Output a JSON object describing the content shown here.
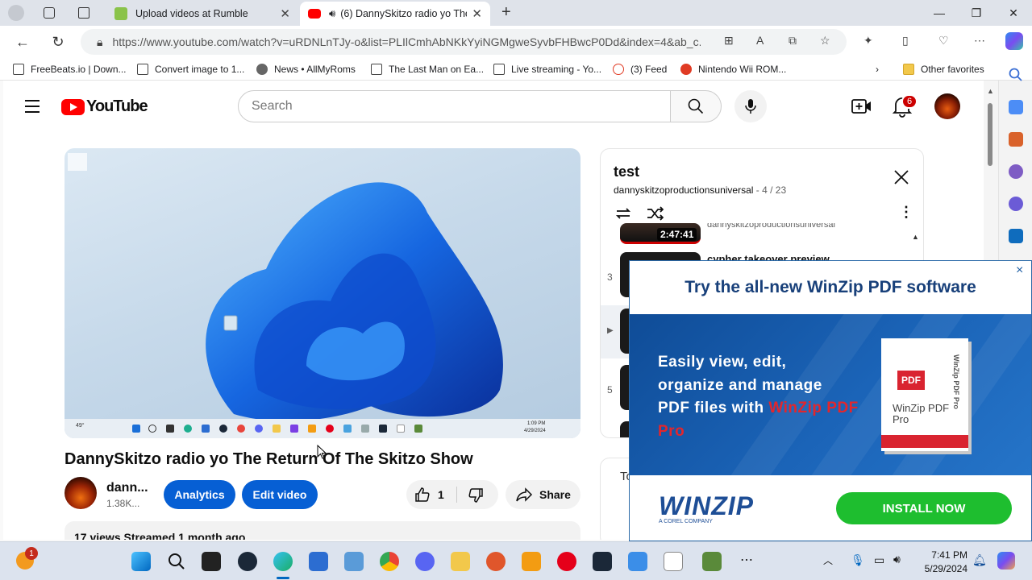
{
  "browser": {
    "tabs": [
      {
        "title": "Upload videos at Rumble",
        "active": false
      },
      {
        "title": "(6) DannySkitzo radio yo The Return Of The Skitzo Show",
        "active": true
      }
    ],
    "url": "https://www.youtube.com/watch?v=uRDNLnTJy-o&list=PLIlCmhAbNKkYyiNGMgweSyvbFHBwcP0Dd&index=4&ab_c...",
    "favorites": [
      "FreeBeats.io | Down...",
      "Convert image to 1...",
      "News • AllMyRoms",
      "The Last Man on Ea...",
      "Live streaming - Yo...",
      "(3) Feed",
      "Nintendo Wii ROM...",
      "Other favorites"
    ]
  },
  "youtube": {
    "logo_text": "YouTube",
    "search_placeholder": "Search",
    "notification_count": "6",
    "video_title": "DannySkitzo radio yo The Return Of The Skitzo Show",
    "channel_name": "dann...",
    "subscribers": "1.38K...",
    "analytics_label": "Analytics",
    "edit_label": "Edit video",
    "like_count": "1",
    "share_label": "Share",
    "description_meta": "17 views  Streamed 1 month ago",
    "player_time": "1:09 PM",
    "player_date": "4/29/2024",
    "player_temp": "49°",
    "playlist": {
      "title": "test",
      "owner": "dannyskitzoproductionsuniversal",
      "position": "4 / 23",
      "items": [
        {
          "num": "",
          "duration": "2:47:41",
          "title": "dannyskitzoproductionsuniversal"
        },
        {
          "num": "3",
          "title": "cypher takeover preview"
        },
        {
          "num": "▶",
          "title": ""
        },
        {
          "num": "5",
          "title": ""
        }
      ]
    },
    "related_stub": "To"
  },
  "ad": {
    "headline": "Try the all-new WinZip PDF software",
    "copy_line1": "Easily view, edit,",
    "copy_line2": "organize and manage",
    "copy_line3": "PDF files with",
    "copy_highlight": "WinZip PDF Pro",
    "box_label": "WinZip PDF Pro",
    "box_side": "WinZip PDF Pro",
    "box_badge": "PDF",
    "brand": "WINZIP",
    "brand_sub": "A COREL COMPANY",
    "cta": "INSTALL NOW",
    "close": "×"
  },
  "taskbar": {
    "time": "7:41 PM",
    "date": "5/29/2024",
    "weather_badge": "1"
  },
  "colors": {
    "yt_red": "#ff0000",
    "yt_blue_button": "#065fd4",
    "ad_blue": "#1b64b8",
    "ad_red": "#e3262c",
    "ad_green": "#1ebe2f"
  }
}
